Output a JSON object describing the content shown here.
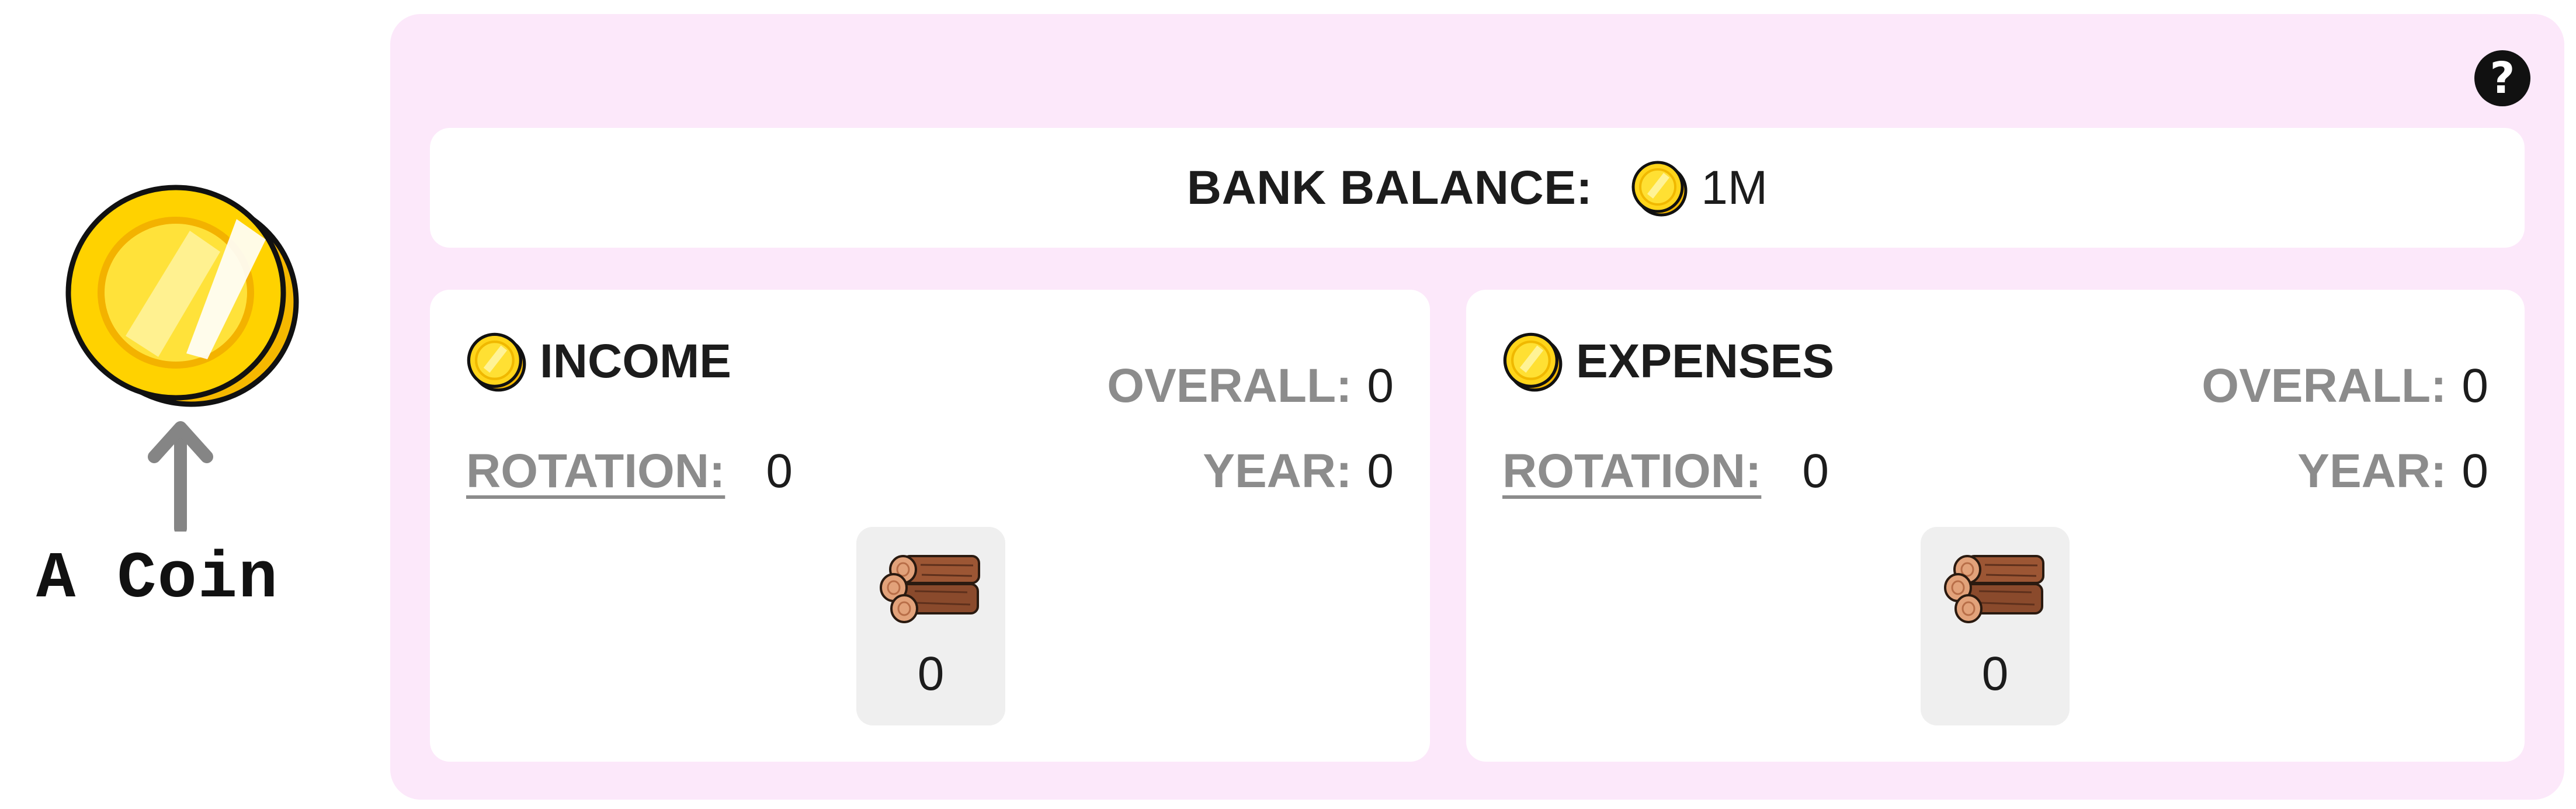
{
  "annotation": {
    "label": "A Coin",
    "coin_icon": "gold-coin-icon",
    "arrow_icon": "arrow-up-icon"
  },
  "help": {
    "icon": "question-circle-icon",
    "glyph": "?"
  },
  "bank": {
    "label": "BANK BALANCE:",
    "value": "1M",
    "icon": "coin-icon"
  },
  "income": {
    "title": "INCOME",
    "icon": "coin-icon",
    "overall_label": "OVERALL:",
    "overall_value": "0",
    "rotation_label": "ROTATION:",
    "rotation_value": "0",
    "year_label": "YEAR:",
    "year_value": "0",
    "wood": {
      "icon": "wood-logs-icon",
      "value": "0"
    }
  },
  "expenses": {
    "title": "EXPENSES",
    "icon": "coin-icon",
    "overall_label": "OVERALL:",
    "overall_value": "0",
    "rotation_label": "ROTATION:",
    "rotation_value": "0",
    "year_label": "YEAR:",
    "year_value": "0",
    "wood": {
      "icon": "wood-logs-icon",
      "value": "0"
    }
  },
  "colors": {
    "panel_bg": "#fce8fa",
    "card_bg": "#ffffff",
    "muted_label": "#8c8c8c",
    "coin_gold": "#ffd200",
    "tile_bg": "#efefef"
  }
}
